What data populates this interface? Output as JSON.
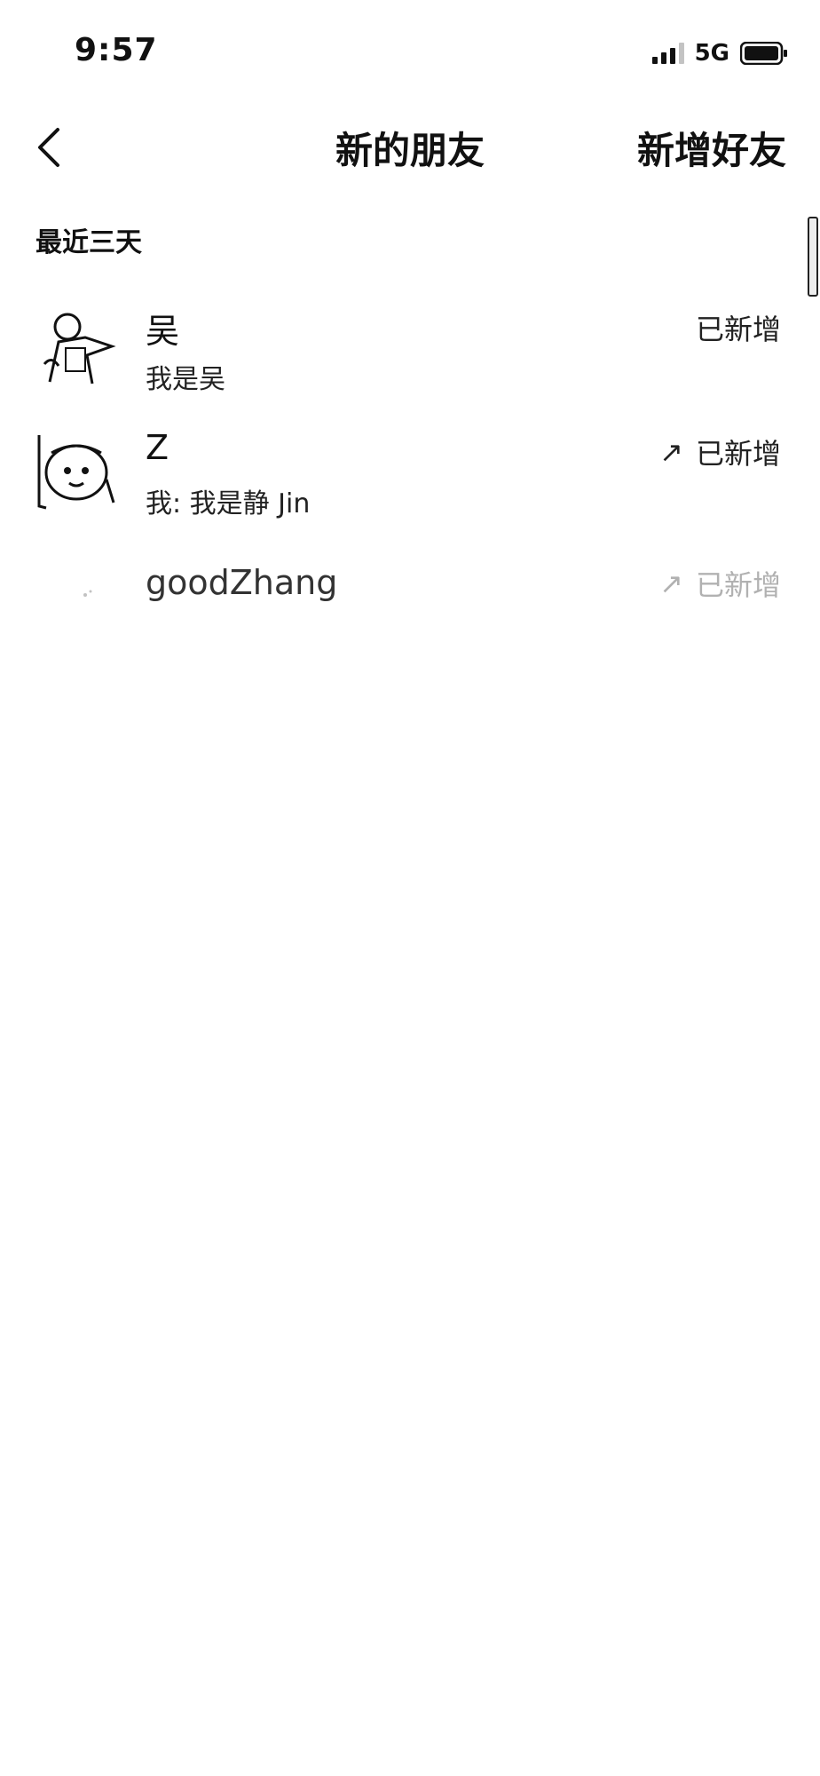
{
  "status_bar": {
    "time": "9:57",
    "network": "5G"
  },
  "nav": {
    "title": "新的朋友",
    "action": "新增好友"
  },
  "section": {
    "title": "最近三天"
  },
  "friends": [
    {
      "name": "吴",
      "message": "我是吴",
      "status": "已新增",
      "arrow": ""
    },
    {
      "name": "Z",
      "message": "我: 我是静 Jin",
      "status": "已新增",
      "arrow": "↗"
    },
    {
      "name": "goodZhang",
      "message": "",
      "status": "已新增",
      "arrow": "↗"
    }
  ],
  "icons": {
    "back": "chevron-left-icon",
    "signal": "signal-icon",
    "battery": "battery-icon"
  }
}
